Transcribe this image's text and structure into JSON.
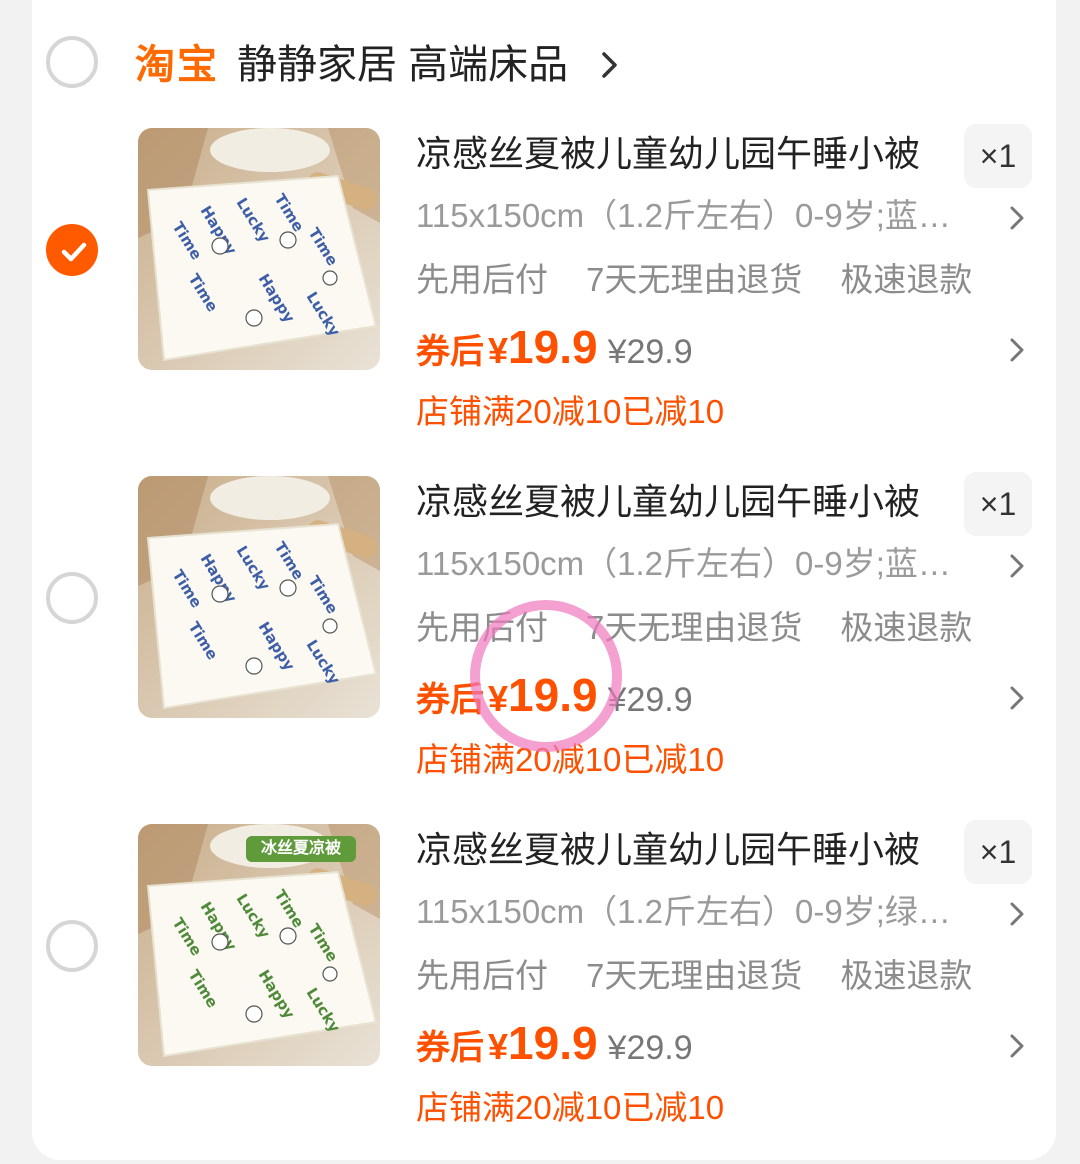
{
  "shop": {
    "brand": "淘宝",
    "name": "静静家居 高端床品"
  },
  "items": [
    {
      "checked": true,
      "title": "凉感丝夏被儿童幼儿园午睡小被",
      "qty": "×1",
      "spec": "115x150cm（1.2斤左右）0-9岁;蓝…",
      "tags": [
        "先用后付",
        "7天无理由退货",
        "极速退款"
      ],
      "coupon_label": "券后",
      "price_symbol": "¥",
      "price": "19.9",
      "original_price": "¥29.9",
      "promo": "店铺满20减10已减10",
      "print_color": "#3e5fa8",
      "badge": ""
    },
    {
      "checked": false,
      "title": "凉感丝夏被儿童幼儿园午睡小被",
      "qty": "×1",
      "spec": "115x150cm（1.2斤左右）0-9岁;蓝…",
      "tags": [
        "先用后付",
        "7天无理由退货",
        "极速退款"
      ],
      "coupon_label": "券后",
      "price_symbol": "¥",
      "price": "19.9",
      "original_price": "¥29.9",
      "promo": "店铺满20减10已减10",
      "print_color": "#3e5fa8",
      "badge": ""
    },
    {
      "checked": false,
      "title": "凉感丝夏被儿童幼儿园午睡小被",
      "qty": "×1",
      "spec": "115x150cm（1.2斤左右）0-9岁;绿…",
      "tags": [
        "先用后付",
        "7天无理由退货",
        "极速退款"
      ],
      "coupon_label": "券后",
      "price_symbol": "¥",
      "price": "19.9",
      "original_price": "¥29.9",
      "promo": "店铺满20减10已减10",
      "print_color": "#4f8a3a",
      "badge": "冰丝夏凉被"
    }
  ],
  "colors": {
    "accent": "#ff5000",
    "brand": "#ff6a00",
    "checkbox_checked": "#ff5a00",
    "highlight_circle": "#f078be"
  },
  "icons": {
    "check": "checkmark-icon",
    "chevron": "chevron-right-icon"
  }
}
